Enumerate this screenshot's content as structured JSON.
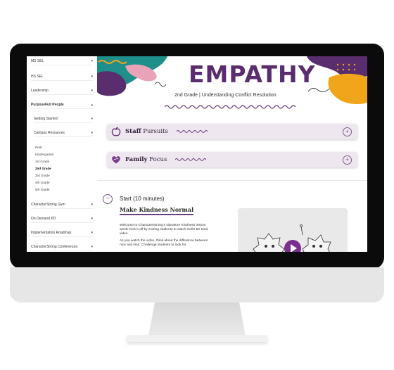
{
  "sidebar": {
    "items": [
      {
        "label": "MS SEL"
      },
      {
        "label": "HS SEL"
      },
      {
        "label": "Leadership"
      },
      {
        "label": "PurposeFull People"
      },
      {
        "label": "Getting Started"
      },
      {
        "label": "Campus Resources"
      },
      {
        "label": "CharacterStrong Gym"
      },
      {
        "label": "On Demand PD"
      },
      {
        "label": "Implementation Roadmap"
      },
      {
        "label": "CharacterStrong Conferences"
      }
    ],
    "grades": [
      "PreK",
      "Kindergarten",
      "1st Grade",
      "2nd Grade",
      "3rd Grade",
      "4th Grade",
      "5th Grade"
    ],
    "active_grade": "2nd Grade"
  },
  "hero": {
    "title": "EMPATHY",
    "subtitle": "2nd Grade  |  Understanding Conflict Resolution"
  },
  "sections": {
    "staff": {
      "title_bold": "Staff",
      "title_rest": " Pursuits"
    },
    "family": {
      "title_bold": "Family",
      "title_rest": " Focus"
    }
  },
  "lesson": {
    "start_label": "Start",
    "start_time": " (10 minutes)",
    "heading": "Make Kindness Normal",
    "para1": "Welcome to CharacterStrong's signature Kindness lesson week! Kick it off by inviting students to watch Soli's Be Kind video.",
    "para2": "As you watch the video, think about the difference between nice and kind. Challenge students to look for"
  },
  "colors": {
    "purple": "#5a2e6e",
    "teal": "#1e8f8a",
    "orange": "#f0a51a",
    "pink": "#e8a3b8",
    "card_bg": "#efe7ef"
  },
  "icons": [
    "chevron-down-icon",
    "chevron-up-icon",
    "apple-icon",
    "heart-icon",
    "plus-circle-icon",
    "minus-circle-icon",
    "play-icon"
  ]
}
